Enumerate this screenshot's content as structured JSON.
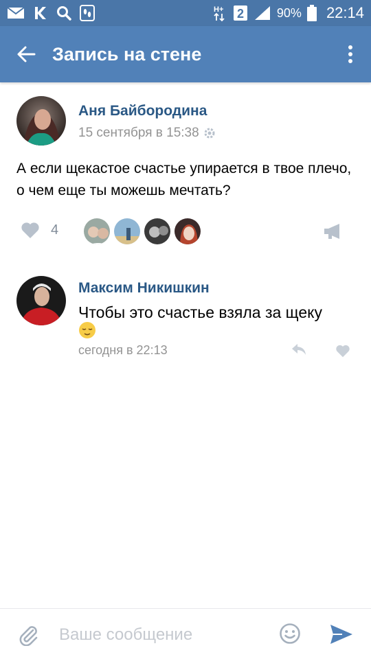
{
  "status_bar": {
    "network_type": "H+",
    "sim_slot": "2",
    "battery": "90%",
    "time": "22:14"
  },
  "header": {
    "title": "Запись на стене"
  },
  "post": {
    "author": "Аня Байбородина",
    "date": "15 сентября в 15:38",
    "text": "А если щекастое счастье упирается в твое плечо, о чем еще ты можешь мечтать?",
    "like_count": "4"
  },
  "comment": {
    "author": "Максим Никишкин",
    "text": "Чтобы это счастье взяла за щеку",
    "date": "сегодня в 22:13"
  },
  "composer": {
    "placeholder": "Ваше сообщение"
  },
  "colors": {
    "status_bar": "#4a76a8",
    "header": "#5181b8",
    "link": "#2a5885",
    "muted": "#939393",
    "icon": "#b8c1cc"
  }
}
